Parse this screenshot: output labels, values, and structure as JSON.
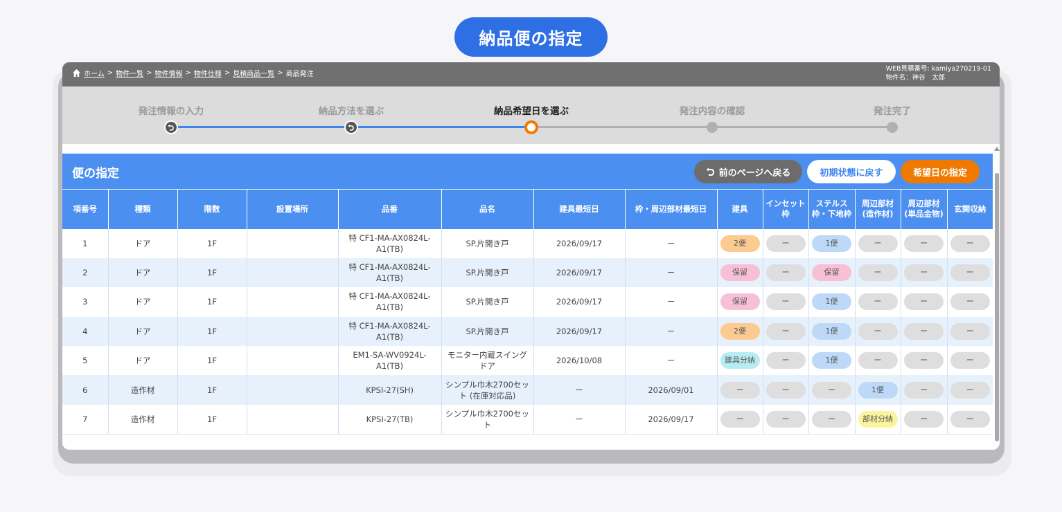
{
  "page_title": "納品便の指定",
  "breadcrumb": {
    "items": [
      "ホーム",
      "物件一覧",
      "物件情報",
      "物件仕様",
      "見積商品一覧"
    ],
    "current": "商品発注",
    "separator": ">"
  },
  "meta": {
    "estimate_no": "WEB見積番号: kamiya270219-01",
    "property_name": "物件名：神谷　太郎"
  },
  "steps": [
    {
      "label": "発注情報の入力",
      "state": "done"
    },
    {
      "label": "納品方法を選ぶ",
      "state": "done"
    },
    {
      "label": "納品希望日を選ぶ",
      "state": "active"
    },
    {
      "label": "発注内容の確認",
      "state": "todo"
    },
    {
      "label": "発注完了",
      "state": "todo"
    }
  ],
  "panel": {
    "title": "便の指定",
    "prev_button": "前のページへ戻る",
    "reset_button": "初期状態に戻す",
    "date_button": "希望日の指定"
  },
  "table": {
    "headers": [
      "項番号",
      "種類",
      "階数",
      "設置場所",
      "品番",
      "品名",
      "建具最短日",
      "枠・周辺部材最短日",
      "建具",
      "インセット枠",
      "ステルス枠・下地枠",
      "周辺部材(造作材)",
      "周辺部材(単品金物)",
      "玄関収納"
    ],
    "header_lines": [
      [
        "項番号"
      ],
      [
        "種類"
      ],
      [
        "階数"
      ],
      [
        "設置場所"
      ],
      [
        "品番"
      ],
      [
        "品名"
      ],
      [
        "建具最短日"
      ],
      [
        "枠・周辺部材最短日"
      ],
      [
        "建具"
      ],
      [
        "インセット",
        "枠"
      ],
      [
        "ステルス",
        "枠・下地枠"
      ],
      [
        "周辺部材",
        "(造作材)"
      ],
      [
        "周辺部材",
        "(単品金物)"
      ],
      [
        "玄関収納"
      ]
    ],
    "rows": [
      {
        "no": "1",
        "type": "ドア",
        "floor": "1F",
        "location": "",
        "part_no": "特 CF1-MA-AX0824L-A1(TB)",
        "name": "SP.片開き戸",
        "door_date": "2026/09/17",
        "frame_date": "ー",
        "pills": [
          {
            "text": "2便",
            "color": "orange"
          },
          {
            "text": "ー",
            "color": "gray"
          },
          {
            "text": "1便",
            "color": "blue"
          },
          {
            "text": "ー",
            "color": "gray"
          },
          {
            "text": "ー",
            "color": "gray"
          },
          {
            "text": "ー",
            "color": "gray"
          }
        ]
      },
      {
        "no": "2",
        "type": "ドア",
        "floor": "1F",
        "location": "",
        "part_no": "特 CF1-MA-AX0824L-A1(TB)",
        "name": "SP.片開き戸",
        "door_date": "2026/09/17",
        "frame_date": "ー",
        "pills": [
          {
            "text": "保留",
            "color": "pink"
          },
          {
            "text": "ー",
            "color": "gray"
          },
          {
            "text": "保留",
            "color": "pink"
          },
          {
            "text": "ー",
            "color": "gray"
          },
          {
            "text": "ー",
            "color": "gray"
          },
          {
            "text": "ー",
            "color": "gray"
          }
        ]
      },
      {
        "no": "3",
        "type": "ドア",
        "floor": "1F",
        "location": "",
        "part_no": "特 CF1-MA-AX0824L-A1(TB)",
        "name": "SP.片開き戸",
        "door_date": "2026/09/17",
        "frame_date": "ー",
        "pills": [
          {
            "text": "保留",
            "color": "pink"
          },
          {
            "text": "ー",
            "color": "gray"
          },
          {
            "text": "1便",
            "color": "blue"
          },
          {
            "text": "ー",
            "color": "gray"
          },
          {
            "text": "ー",
            "color": "gray"
          },
          {
            "text": "ー",
            "color": "gray"
          }
        ]
      },
      {
        "no": "4",
        "type": "ドア",
        "floor": "1F",
        "location": "",
        "part_no": "特 CF1-MA-AX0824L-A1(TB)",
        "name": "SP.片開き戸",
        "door_date": "2026/09/17",
        "frame_date": "ー",
        "pills": [
          {
            "text": "2便",
            "color": "orange"
          },
          {
            "text": "ー",
            "color": "gray"
          },
          {
            "text": "1便",
            "color": "blue"
          },
          {
            "text": "ー",
            "color": "gray"
          },
          {
            "text": "ー",
            "color": "gray"
          },
          {
            "text": "ー",
            "color": "gray"
          }
        ]
      },
      {
        "no": "5",
        "type": "ドア",
        "floor": "1F",
        "location": "",
        "part_no": "EM1-SA-WV0924L-A1(TB)",
        "name": "モニター内蔵スイングドア",
        "door_date": "2026/10/08",
        "frame_date": "ー",
        "pills": [
          {
            "text": "建具分納",
            "color": "cyan"
          },
          {
            "text": "ー",
            "color": "gray"
          },
          {
            "text": "1便",
            "color": "blue"
          },
          {
            "text": "ー",
            "color": "gray"
          },
          {
            "text": "ー",
            "color": "gray"
          },
          {
            "text": "ー",
            "color": "gray"
          }
        ]
      },
      {
        "no": "6",
        "type": "造作材",
        "floor": "1F",
        "location": "",
        "part_no": "KPSI-27(SH)",
        "name": "シンプル巾木2700セット (在庫対応品)",
        "door_date": "ー",
        "frame_date": "2026/09/01",
        "pills": [
          {
            "text": "ー",
            "color": "gray"
          },
          {
            "text": "ー",
            "color": "gray"
          },
          {
            "text": "ー",
            "color": "gray"
          },
          {
            "text": "1便",
            "color": "blue"
          },
          {
            "text": "ー",
            "color": "gray"
          },
          {
            "text": "ー",
            "color": "gray"
          }
        ]
      },
      {
        "no": "7",
        "type": "造作材",
        "floor": "1F",
        "location": "",
        "part_no": "KPSI-27(TB)",
        "name": "シンプル巾木2700セット",
        "door_date": "ー",
        "frame_date": "2026/09/17",
        "pills": [
          {
            "text": "ー",
            "color": "gray"
          },
          {
            "text": "ー",
            "color": "gray"
          },
          {
            "text": "ー",
            "color": "gray"
          },
          {
            "text": "部材分納",
            "color": "yellow"
          },
          {
            "text": "ー",
            "color": "gray"
          },
          {
            "text": "ー",
            "color": "gray"
          }
        ]
      }
    ]
  },
  "colors": {
    "primary_blue": "#4b8ff0",
    "title_blue": "#2f6fe4",
    "accent_orange": "#f07a00",
    "topbar_gray": "#707070",
    "row_alt": "#e6f1fc"
  }
}
